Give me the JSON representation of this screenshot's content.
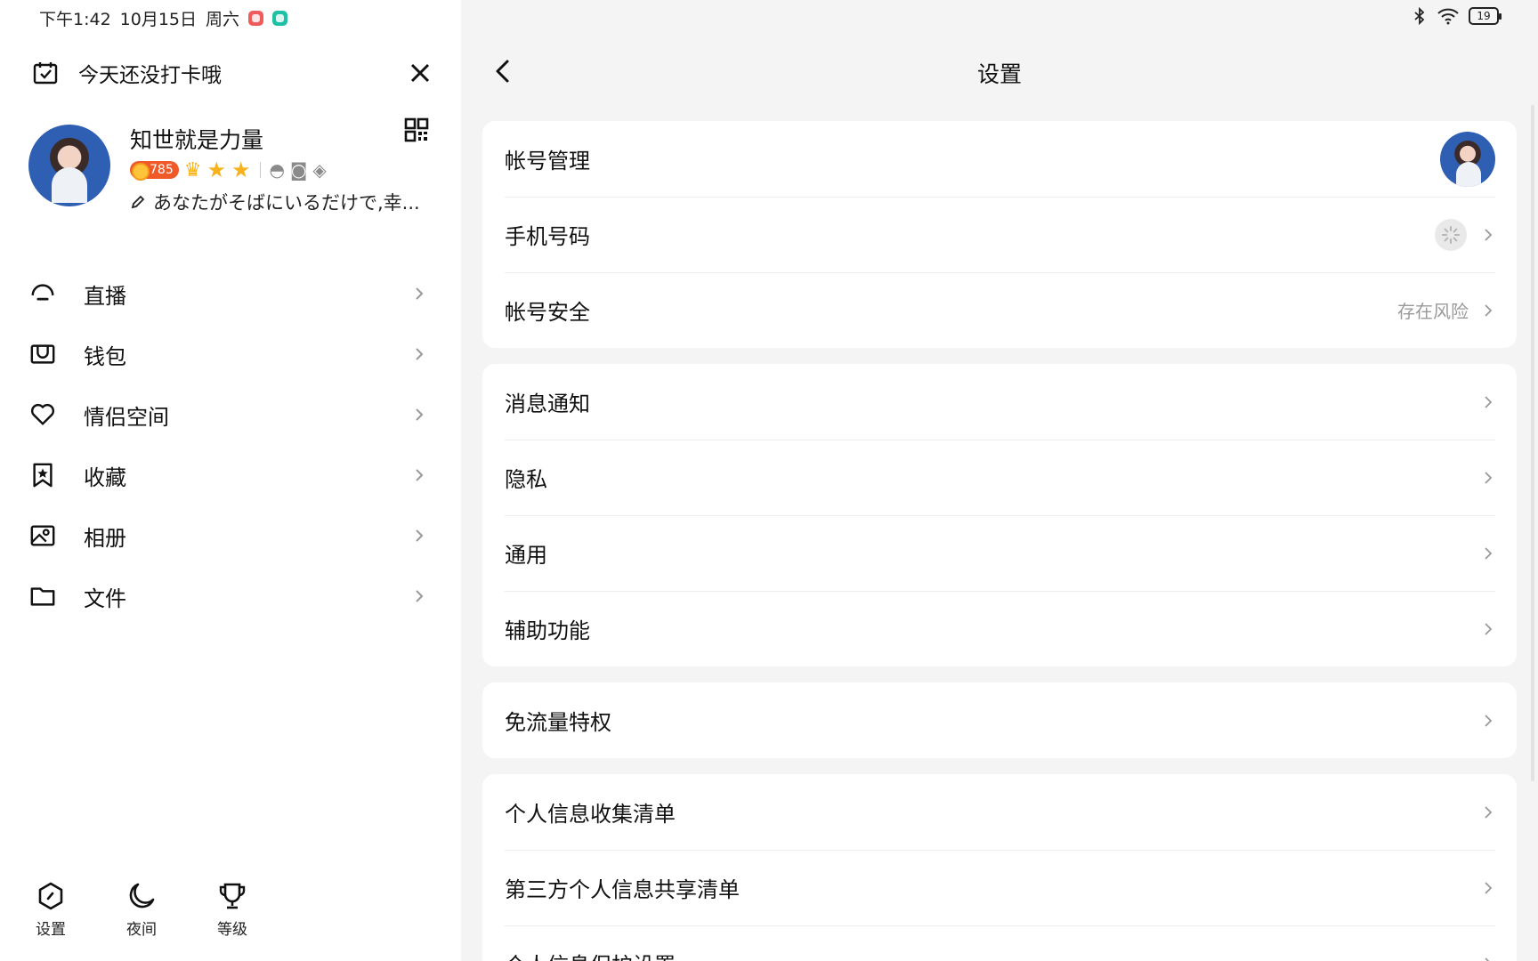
{
  "status_bar": {
    "time": "下午1:42",
    "date": "10月15日",
    "weekday": "周六",
    "battery": "19"
  },
  "drawer": {
    "checkin_text": "今天还没打卡哦",
    "profile": {
      "name": "知世就是力量",
      "coin_count": "785",
      "motto": "あなたがそばにいるだけで,幸..."
    },
    "menu": [
      {
        "label": "直播",
        "icon": "live-icon"
      },
      {
        "label": "钱包",
        "icon": "wallet-icon"
      },
      {
        "label": "情侣空间",
        "icon": "heart-icon"
      },
      {
        "label": "收藏",
        "icon": "bookmark-star-icon"
      },
      {
        "label": "相册",
        "icon": "album-icon"
      },
      {
        "label": "文件",
        "icon": "folder-icon"
      }
    ],
    "bottom": [
      {
        "label": "设置",
        "icon": "settings-hex-icon"
      },
      {
        "label": "夜间",
        "icon": "moon-icon"
      },
      {
        "label": "等级",
        "icon": "trophy-icon"
      }
    ]
  },
  "settings": {
    "title": "设置",
    "groups": [
      [
        {
          "label": "帐号管理",
          "value": "",
          "trailing": "avatar"
        },
        {
          "label": "手机号码",
          "value": "",
          "trailing": "spinner"
        },
        {
          "label": "帐号安全",
          "value": "存在风险",
          "trailing": "chevron"
        }
      ],
      [
        {
          "label": "消息通知"
        },
        {
          "label": "隐私"
        },
        {
          "label": "通用"
        },
        {
          "label": "辅助功能"
        }
      ],
      [
        {
          "label": "免流量特权"
        }
      ],
      [
        {
          "label": "个人信息收集清单"
        },
        {
          "label": "第三方个人信息共享清单"
        },
        {
          "label": "个人信息保护设置"
        }
      ]
    ]
  },
  "colors": {
    "accent_orange": "#f05a28",
    "star_gold": "#f7b21c",
    "risk_text": "#9a9a9a",
    "background": "#f4f4f4"
  }
}
